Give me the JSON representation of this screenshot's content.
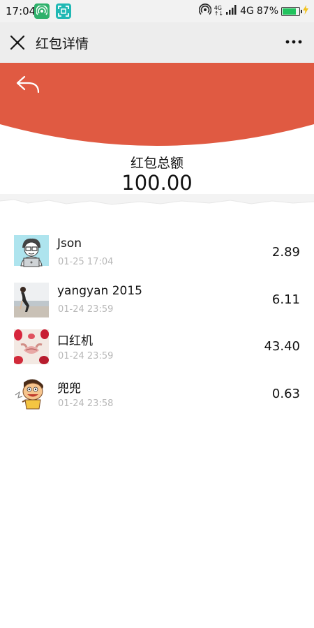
{
  "status_bar": {
    "time": "17:04",
    "network_top": "4G",
    "network_bottom": "↑↓",
    "network_label": "4G",
    "battery": "87%",
    "battery_level": 0.87,
    "battery_color": "#22c35e",
    "icons": [
      "hotspot-app-icon",
      "scan-app-icon",
      "hotspot-icon",
      "signal-icon",
      "battery-icon",
      "charging-icon"
    ]
  },
  "nav": {
    "title": "红包详情",
    "close_icon": "close-icon",
    "more_icon": "more-icon"
  },
  "header": {
    "color": "#e05a42",
    "back_icon": "share-back-icon"
  },
  "summary": {
    "label": "红包总额",
    "amount": "100.00"
  },
  "records": [
    {
      "name": "Json",
      "time": "01-25 17:04",
      "amount": "2.89"
    },
    {
      "name": "yangyan 2015",
      "time": "01-24 23:59",
      "amount": "6.11"
    },
    {
      "name": "口红机",
      "time": "01-24 23:59",
      "amount": "43.40"
    },
    {
      "name": "兜兜",
      "time": "01-24 23:58",
      "amount": "0.63"
    }
  ]
}
